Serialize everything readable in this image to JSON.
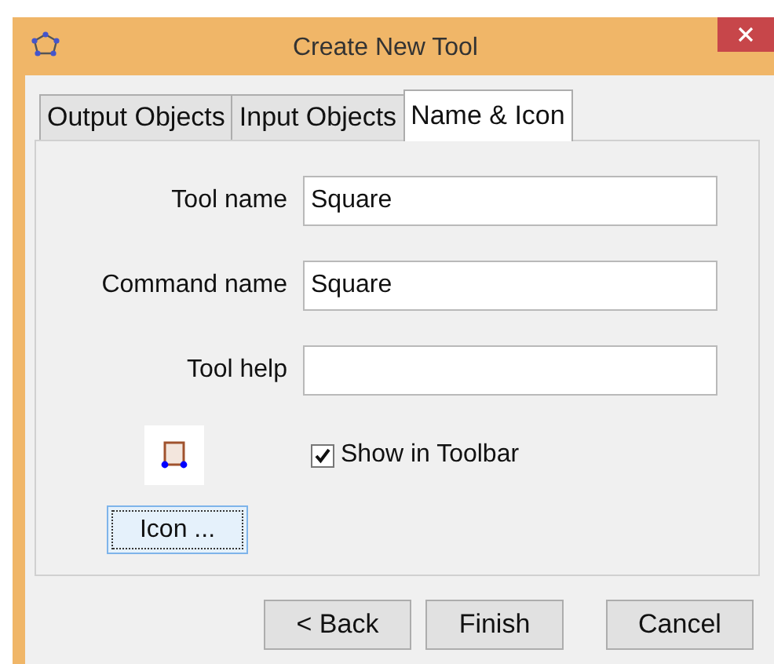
{
  "window": {
    "title": "Create New Tool"
  },
  "tabs": [
    {
      "label": "Output Objects",
      "selected": false
    },
    {
      "label": "Input Objects",
      "selected": false
    },
    {
      "label": "Name & Icon",
      "selected": true
    }
  ],
  "fields": [
    {
      "label": "Tool name",
      "value": "Square"
    },
    {
      "label": "Command name",
      "value": "Square"
    },
    {
      "label": "Tool help"
    }
  ],
  "show_in_toolbar": {
    "label": "Show in Toolbar",
    "checked": true
  },
  "icon_button": {
    "label": "Icon ..."
  },
  "buttons": [
    {
      "label": "< Back"
    },
    {
      "label": "Finish"
    },
    {
      "label": "Cancel"
    }
  ]
}
